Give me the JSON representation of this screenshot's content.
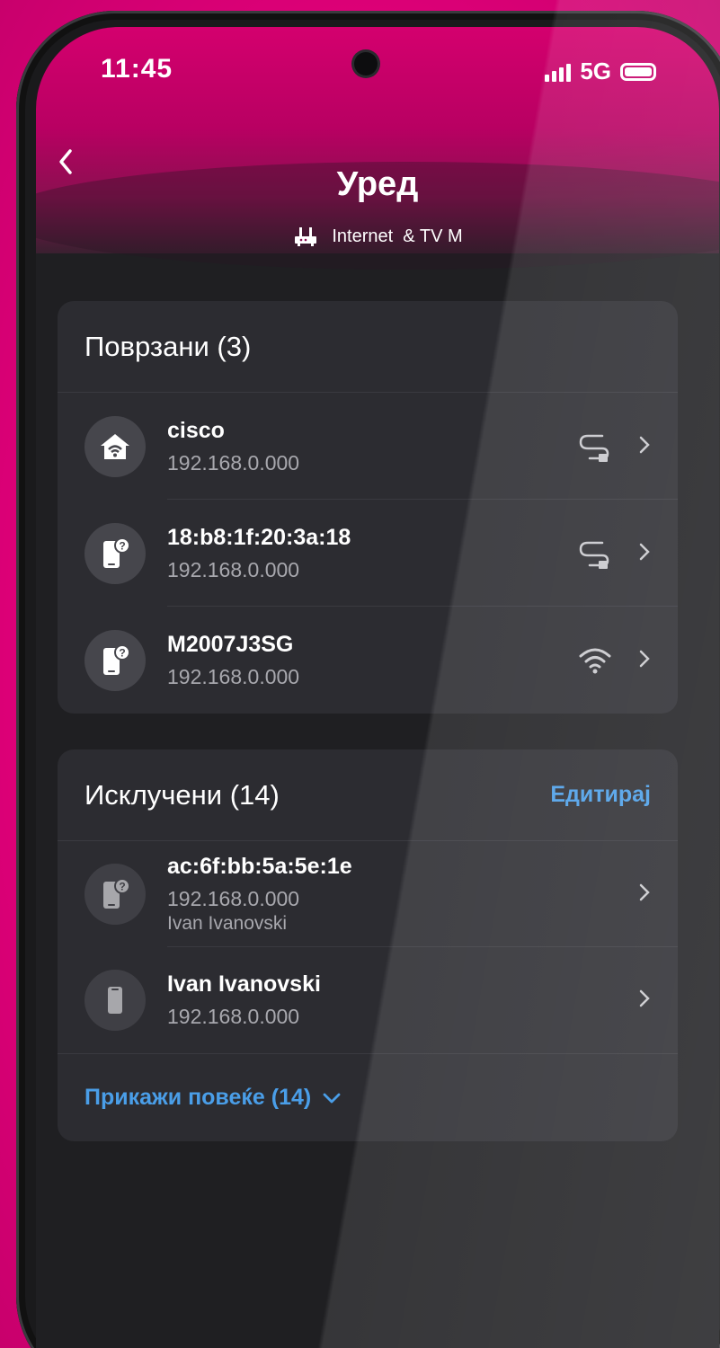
{
  "status_bar": {
    "time": "11:45",
    "network": "5G",
    "signal_icon": "signal-bars-icon",
    "battery_icon": "battery-icon"
  },
  "header": {
    "back_icon": "chevron-left-icon",
    "title": "Уред",
    "subtitle": "Internet  & TV M",
    "subtitle_icon": "router-icon"
  },
  "connected": {
    "title": "Поврзани (3)",
    "devices": [
      {
        "name": "cisco",
        "ip": "192.168.0.000",
        "avatar_icon": "home-wifi-icon",
        "connection_icon": "ethernet-cable-icon"
      },
      {
        "name": "18:b8:1f:20:3a:18",
        "ip": "192.168.0.000",
        "avatar_icon": "unknown-phone-icon",
        "connection_icon": "ethernet-cable-icon"
      },
      {
        "name": "M2007J3SG",
        "ip": "192.168.0.000",
        "avatar_icon": "unknown-phone-icon",
        "connection_icon": "wifi-icon"
      }
    ]
  },
  "disconnected": {
    "title": "Исклучени (14)",
    "edit_label": "Едитирај",
    "devices": [
      {
        "name": "ac:6f:bb:5a:5e:1e",
        "ip": "192.168.0.000",
        "owner": "Ivan Ivanovski",
        "avatar_icon": "unknown-phone-icon"
      },
      {
        "name": "Ivan Ivanovski",
        "ip": "192.168.0.000",
        "avatar_icon": "phone-icon"
      }
    ],
    "show_more_label": "Прикажи повеќе (14)"
  },
  "colors": {
    "brand": "#e2007a",
    "link": "#4a9ee8",
    "card_bg": "#2c2c31",
    "screen_bg": "#1f1f22"
  }
}
